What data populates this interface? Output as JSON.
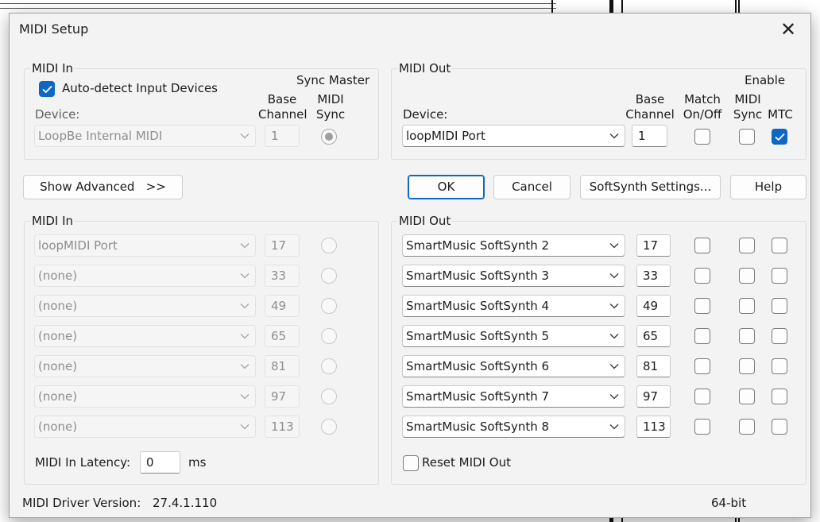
{
  "window": {
    "title": "MIDI Setup",
    "close_glyph": "✕"
  },
  "midi_in": {
    "group_label": "MIDI In",
    "auto_detect": {
      "label": "Auto-detect Input Devices",
      "checked": true
    },
    "sync_master_label": "Sync Master",
    "col_base": "Base",
    "col_channel": "Channel",
    "col_midi": "MIDI",
    "col_sync": "Sync",
    "device_label": "Device:",
    "device": {
      "value": "LoopBe Internal MIDI",
      "channel": "1",
      "sync_selected": true
    }
  },
  "midi_out": {
    "group_label": "MIDI Out",
    "enable_label": "Enable",
    "col_base": "Base",
    "col_channel": "Channel",
    "col_match": "Match",
    "col_onoff": "On/Off",
    "col_midi": "MIDI",
    "col_sync": "Sync",
    "col_mtc": "MTC",
    "device_label": "Device:",
    "device": {
      "value": "loopMIDI Port",
      "channel": "1",
      "match": false,
      "sync": false,
      "mtc": true
    }
  },
  "buttons": {
    "show_advanced": "Show Advanced   >>",
    "ok": "OK",
    "cancel": "Cancel",
    "softsynth": "SoftSynth Settings...",
    "help": "Help"
  },
  "adv_in": {
    "group_label": "MIDI In",
    "rows": [
      {
        "device": "loopMIDI Port",
        "channel": "17"
      },
      {
        "device": "(none)",
        "channel": "33"
      },
      {
        "device": "(none)",
        "channel": "49"
      },
      {
        "device": "(none)",
        "channel": "65"
      },
      {
        "device": "(none)",
        "channel": "81"
      },
      {
        "device": "(none)",
        "channel": "97"
      },
      {
        "device": "(none)",
        "channel": "113"
      }
    ],
    "latency_label": "MIDI In Latency:",
    "latency_value": "0",
    "latency_unit": "ms"
  },
  "adv_out": {
    "group_label": "MIDI Out",
    "rows": [
      {
        "device": "SmartMusic SoftSynth 2",
        "channel": "17"
      },
      {
        "device": "SmartMusic SoftSynth 3",
        "channel": "33"
      },
      {
        "device": "SmartMusic SoftSynth 4",
        "channel": "49"
      },
      {
        "device": "SmartMusic SoftSynth 5",
        "channel": "65"
      },
      {
        "device": "SmartMusic SoftSynth 6",
        "channel": "81"
      },
      {
        "device": "SmartMusic SoftSynth 7",
        "channel": "97"
      },
      {
        "device": "SmartMusic SoftSynth 8",
        "channel": "113"
      }
    ],
    "reset_label": "Reset MIDI Out",
    "reset_checked": false
  },
  "footer": {
    "driver_label": "MIDI Driver Version:",
    "driver_version": "27.4.1.110",
    "bitness": "64-bit"
  },
  "colors": {
    "accent": "#0f67c4",
    "dialog_bg": "#f3f3f3"
  }
}
